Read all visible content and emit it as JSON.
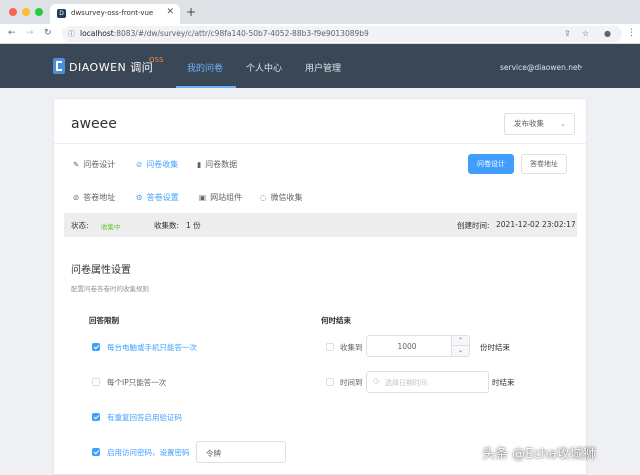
{
  "browser": {
    "tab_title": "dwsurvey-oss-front-vue",
    "tab_favicon": "D",
    "url_host": "localhost",
    "url_rest": ":8083/#/dw/survey/c/attr/c98fa140-50b7-4052-88b3-f9e9013089b9"
  },
  "header": {
    "brand": "DIAOWEN 调问",
    "brand_sup": "OSS",
    "nav": [
      "我的问卷",
      "个人中心",
      "用户管理"
    ],
    "user_email": "service@diaowen.net",
    "colors": {
      "bar": "#3a4756",
      "active": "#6cb2f7",
      "sup": "#e48d4d"
    }
  },
  "survey": {
    "title": "aweee",
    "publish_label": "发布收集"
  },
  "tabs_primary": [
    {
      "label": "问卷设计",
      "icon": "edit-icon"
    },
    {
      "label": "问卷收集",
      "icon": "link-icon",
      "active": true
    },
    {
      "label": "问卷数据",
      "icon": "chart-icon"
    }
  ],
  "actions": {
    "design_button": "问卷设计",
    "address_button": "答卷地址"
  },
  "tabs_secondary": [
    {
      "label": "答卷地址",
      "icon": "link-icon"
    },
    {
      "label": "答卷设置",
      "icon": "gear-icon",
      "active": true
    },
    {
      "label": "网站组件",
      "icon": "widget-icon"
    },
    {
      "label": "微信收集",
      "icon": "chat-icon"
    }
  ],
  "status": {
    "state_label": "状态:",
    "state_value": "收集中",
    "count_label": "收集数:",
    "count_value": "1 份",
    "created_label": "创建时间:",
    "created_value": "2021-12-02 23:02:17"
  },
  "settings": {
    "title": "问卷属性设置",
    "description": "配置问卷答卷时的收集规则",
    "answer_limit": {
      "heading": "回答限制",
      "options": [
        {
          "label": "每台电脑或手机只能答一次",
          "checked": true
        },
        {
          "label": "每个IP只能答一次",
          "checked": false
        },
        {
          "label": "有重复回答启用验证码",
          "checked": true
        },
        {
          "label": "启用访问密码，设置密码",
          "checked": true
        }
      ],
      "password_value": "令牌"
    },
    "end_time": {
      "heading": "何时结束",
      "by_count_label": "收集到",
      "by_count_value": "1000",
      "by_count_suffix": "份时结束",
      "by_time_label": "时间到",
      "by_time_placeholder": "选择日期时间",
      "by_time_suffix": "时结束"
    }
  },
  "watermark": "头条 @Echa攻城狮"
}
